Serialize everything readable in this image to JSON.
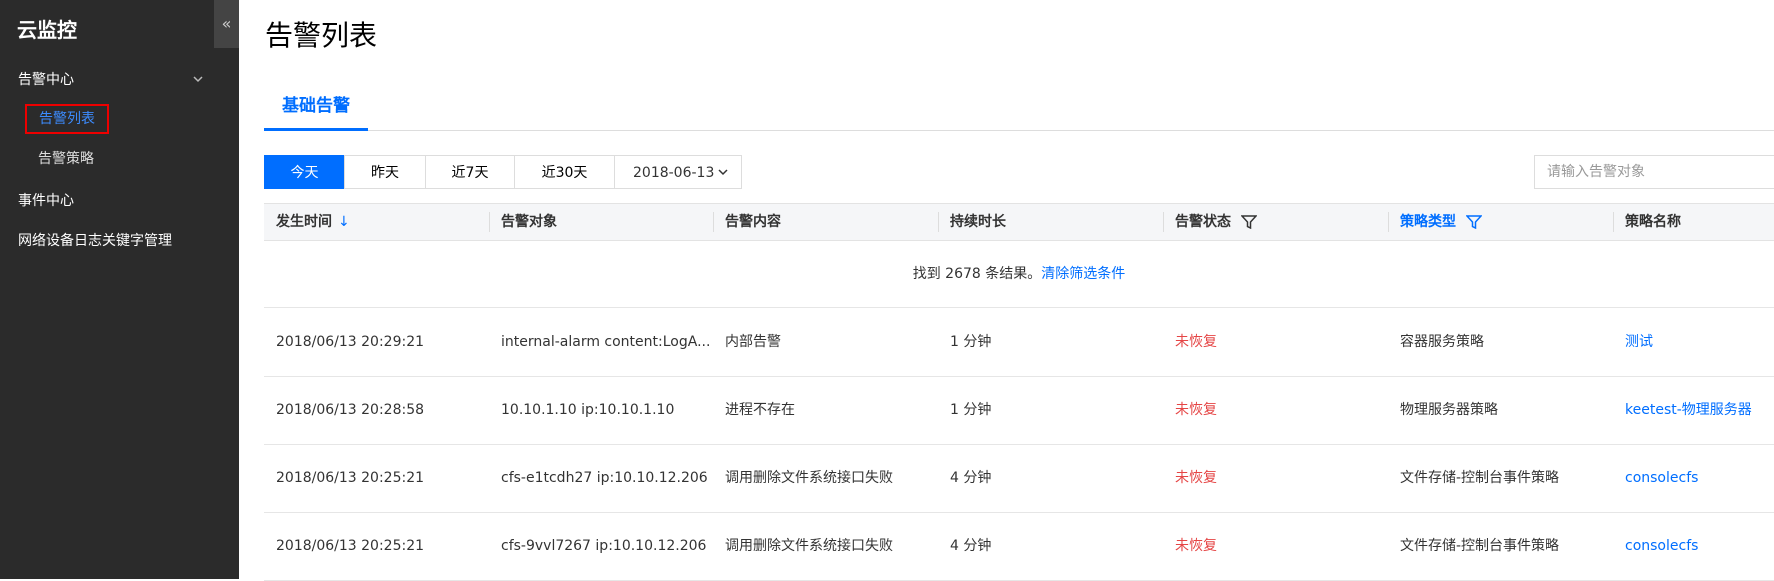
{
  "sidebar": {
    "brand": "云监控",
    "collapse_icon": "«",
    "groups": [
      {
        "label": "告警中心",
        "chevron": "⌄"
      },
      {
        "label": "事件中心"
      },
      {
        "label": "网络设备日志关键字管理"
      }
    ],
    "subitems": [
      {
        "label": "告警列表"
      },
      {
        "label": "告警策略"
      }
    ]
  },
  "main": {
    "title": "告警列表",
    "tabs": [
      {
        "label": "基础告警"
      }
    ],
    "ranges": [
      "今天",
      "昨天",
      "近7天",
      "近30天"
    ],
    "date": "2018-06-13",
    "search_placeholder": "请输入告警对象",
    "columns": [
      "发生时间",
      "告警对象",
      "告警内容",
      "持续时长",
      "告警状态",
      "策略类型",
      "策略名称"
    ],
    "sort_icon": "↓",
    "result_text": "找到 2678 条结果。",
    "clear_filter": "清除筛选条件",
    "rows": [
      {
        "time": "2018/06/13 20:29:21",
        "object": "internal-alarm content:LogA...",
        "content": "内部告警",
        "duration": "1 分钟",
        "status": "未恢复",
        "type": "容器服务策略",
        "policy": "测试"
      },
      {
        "time": "2018/06/13 20:28:58",
        "object": "10.10.1.10 ip:10.10.1.10",
        "content": "进程不存在",
        "duration": "1 分钟",
        "status": "未恢复",
        "type": "物理服务器策略",
        "policy": "keetest-物理服务器"
      },
      {
        "time": "2018/06/13 20:25:21",
        "object": "cfs-e1tcdh27 ip:10.10.12.206",
        "content": "调用删除文件系统接口失败",
        "duration": "4 分钟",
        "status": "未恢复",
        "type": "文件存储-控制台事件策略",
        "policy": "consolecfs"
      },
      {
        "time": "2018/06/13 20:25:21",
        "object": "cfs-9vvl7267 ip:10.10.12.206",
        "content": "调用删除文件系统接口失败",
        "duration": "4 分钟",
        "status": "未恢复",
        "type": "文件存储-控制台事件策略",
        "policy": "consolecfs"
      }
    ]
  },
  "colors": {
    "accent": "#006eff",
    "danger": "#e54545",
    "sidebar_bg": "#2b2b2b",
    "highlight_box": "#e00000"
  }
}
